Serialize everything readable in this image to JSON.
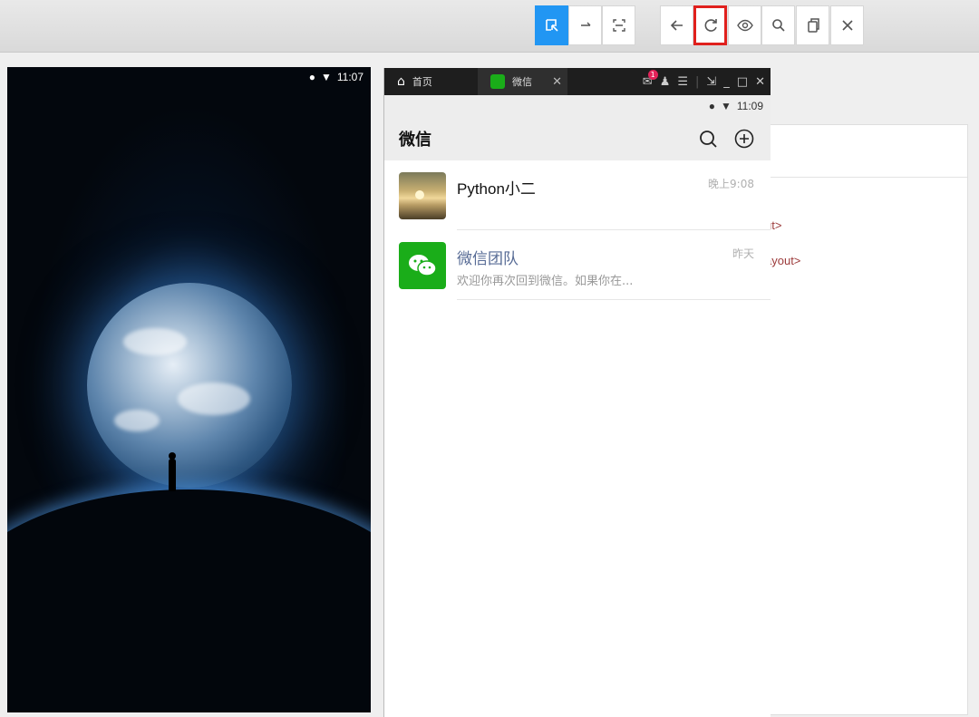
{
  "toolbar": {
    "buttons": [
      {
        "name": "select-element-icon",
        "active": true
      },
      {
        "name": "swipe-icon"
      },
      {
        "name": "tap-by-coordinates-icon"
      },
      {
        "name": "back-arrow-icon"
      },
      {
        "name": "refresh-icon",
        "highlighted": true
      },
      {
        "name": "eye-icon"
      },
      {
        "name": "search-icon"
      },
      {
        "name": "copy-icon"
      },
      {
        "name": "close-icon"
      }
    ]
  },
  "device": {
    "status_time": "11:07"
  },
  "inspector": {
    "nodes": [
      "ut>",
      "ayout>"
    ]
  },
  "emulator": {
    "tabs": [
      {
        "label": "首页",
        "icon": "home-icon"
      },
      {
        "label": "微信",
        "icon": "wechat-icon"
      }
    ],
    "notification_count": "1",
    "status_time": "11:09",
    "app_title": "微信",
    "chats": [
      {
        "name": "Python小二",
        "message": "",
        "time": "晚上9:08",
        "avatar": "sunset-photo"
      },
      {
        "name": "微信团队",
        "message": "欢迎你再次回到微信。如果你在...",
        "time": "昨天",
        "avatar": "wechat-logo"
      }
    ]
  },
  "colors": {
    "accent": "#2196f3",
    "highlight": "#e0201d",
    "wechat_green": "#1aad19",
    "team_name": "#576b95"
  }
}
